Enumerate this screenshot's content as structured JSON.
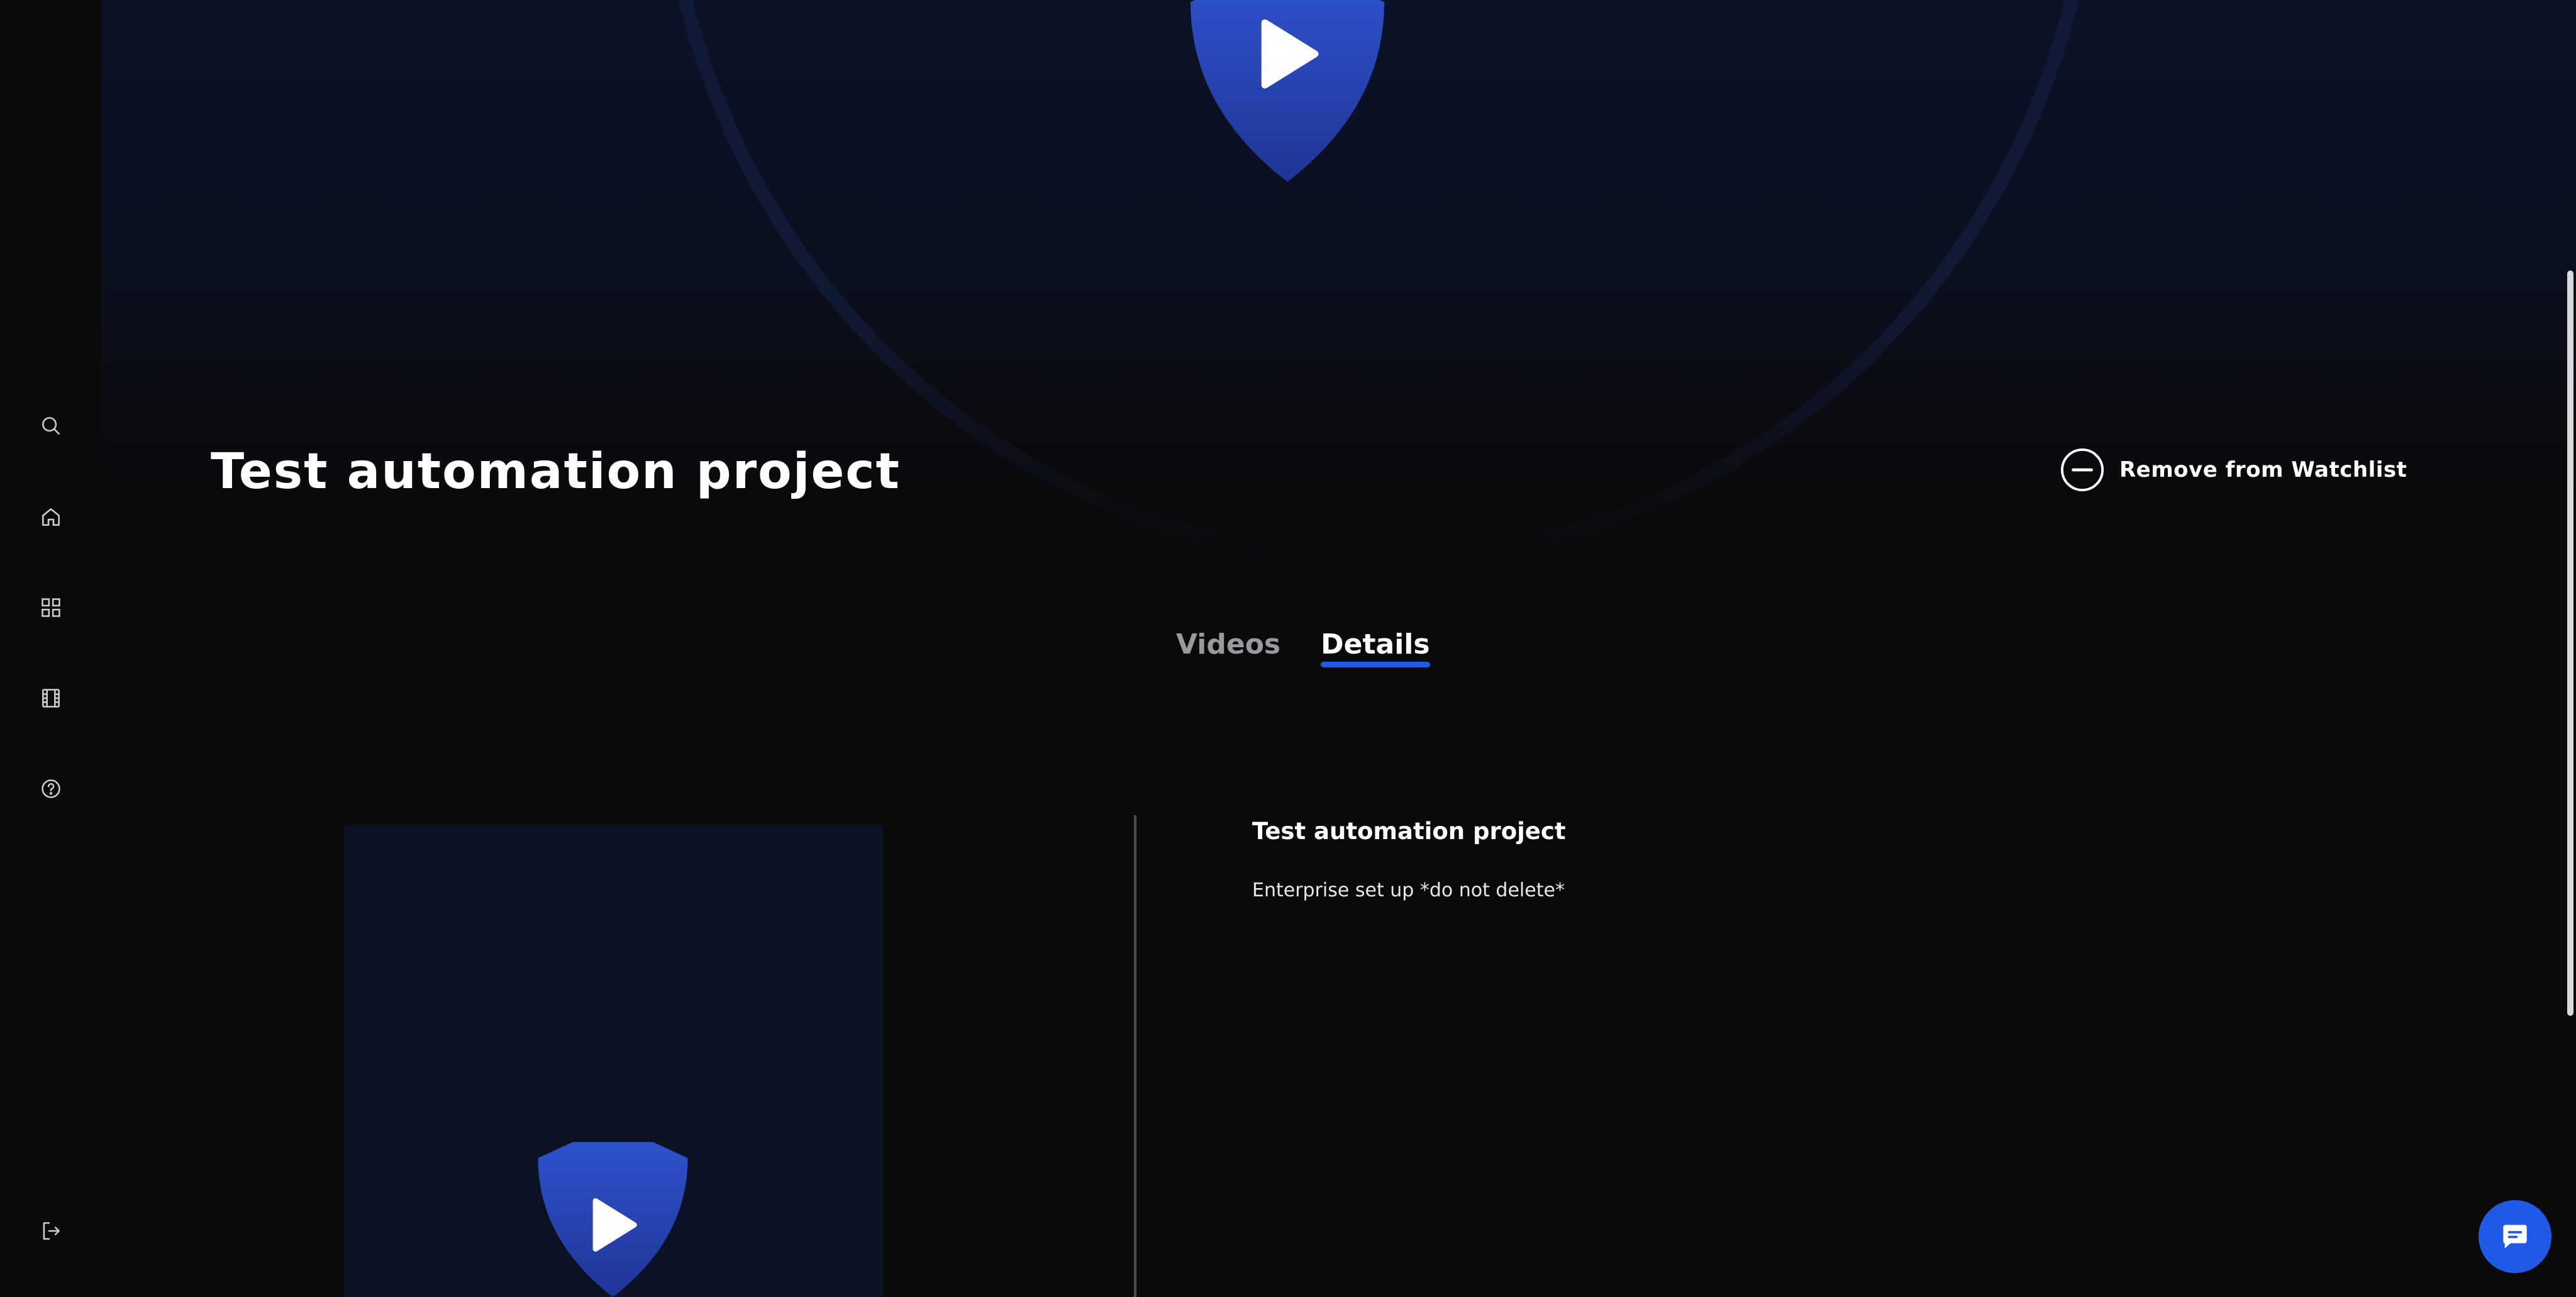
{
  "sidebar": {
    "items": [
      {
        "icon": "search-icon"
      },
      {
        "icon": "home-icon"
      },
      {
        "icon": "grid-icon"
      },
      {
        "icon": "film-icon"
      },
      {
        "icon": "help-icon"
      },
      {
        "icon": "logout-icon"
      }
    ]
  },
  "hero": {
    "logo": "shield-play-logo"
  },
  "project": {
    "title": "Test automation project"
  },
  "watchlist": {
    "label": "Remove from Watchlist",
    "icon": "minus-circle-icon"
  },
  "tabs": [
    {
      "label": "Videos",
      "active": false
    },
    {
      "label": "Details",
      "active": true
    }
  ],
  "details": {
    "title": "Test automation project",
    "description": "Enterprise set up *do not delete*"
  },
  "chat": {
    "icon": "chat-icon"
  },
  "colors": {
    "accent": "#1e5ae6",
    "background": "#0a0a0b",
    "hero_top": "#0b1226",
    "shield_blue": "#2a4cc0"
  }
}
